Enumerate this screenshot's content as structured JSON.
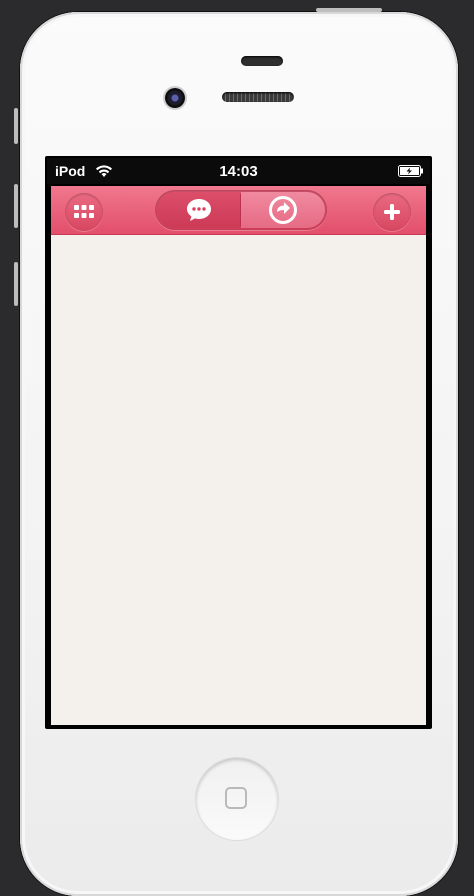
{
  "status_bar": {
    "carrier": "iPod",
    "time": "14:03",
    "wifi_icon": "wifi-icon",
    "battery_icon": "battery-charging-icon"
  },
  "nav_bar": {
    "accent_color": "#e4536e",
    "menu_icon": "grid-icon",
    "segment_left_icon": "speech-bubble-icon",
    "segment_right_icon": "forward-arrow-icon",
    "add_icon": "plus-icon",
    "selected_segment": "right"
  },
  "content": {
    "background_color": "#f4f1ec"
  }
}
